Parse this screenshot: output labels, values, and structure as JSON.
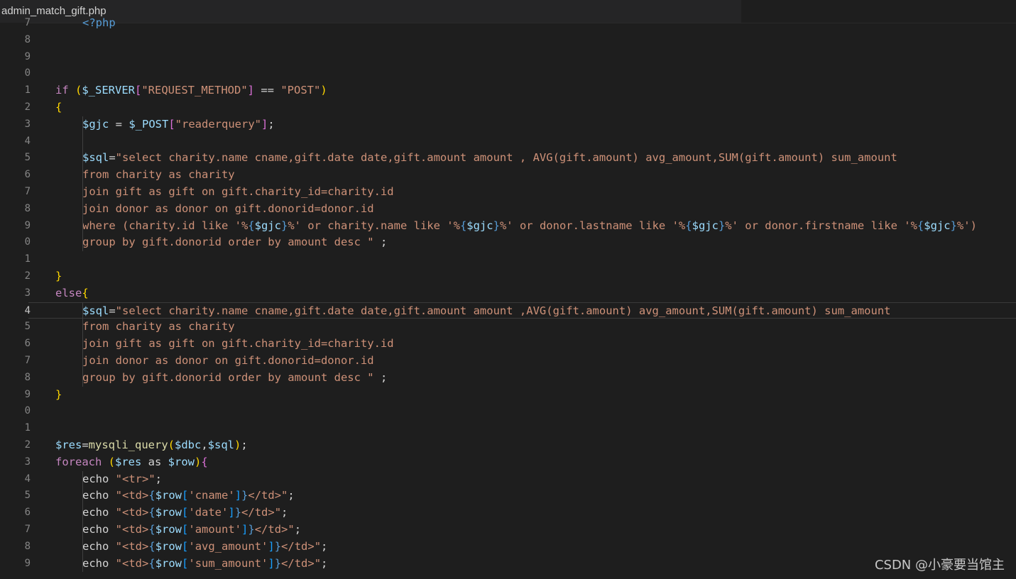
{
  "tab": {
    "filename": "admin_match_gift.php"
  },
  "watermark": "CSDN @小豪要当馆主",
  "colors": {
    "background": "#1e1e1e",
    "keyword": "#569cd6",
    "variable": "#9cdcfe",
    "string": "#ce9178",
    "function": "#dcdcaa",
    "brace": "#ffd700",
    "paren": "#da70d6",
    "bracket": "#179fff"
  },
  "current_line_number": "4",
  "lines": [
    {
      "num": "7",
      "indent": 1,
      "tokens": [
        [
          "t-kw",
          "<?php"
        ]
      ]
    },
    {
      "num": "8",
      "indent": 0,
      "tokens": []
    },
    {
      "num": "9",
      "indent": 0,
      "tokens": []
    },
    {
      "num": "0",
      "indent": 0,
      "tokens": []
    },
    {
      "num": "1",
      "indent": 0,
      "tokens": [
        [
          "t-ctrl",
          "if "
        ],
        [
          "t-brace",
          "("
        ],
        [
          "t-var",
          "$_SERVER"
        ],
        [
          "t-paren",
          "["
        ],
        [
          "t-str",
          "\"REQUEST_METHOD\""
        ],
        [
          "t-paren",
          "]"
        ],
        [
          "t-plain",
          " == "
        ],
        [
          "t-str",
          "\"POST\""
        ],
        [
          "t-brace",
          ")"
        ]
      ]
    },
    {
      "num": "2",
      "indent": 0,
      "tokens": [
        [
          "t-brace",
          "{"
        ]
      ]
    },
    {
      "num": "3",
      "indent": 1,
      "tokens": [
        [
          "t-var",
          "$gjc"
        ],
        [
          "t-plain",
          " = "
        ],
        [
          "t-var",
          "$_POST"
        ],
        [
          "t-paren",
          "["
        ],
        [
          "t-str",
          "\"readerquery\""
        ],
        [
          "t-paren",
          "]"
        ],
        [
          "t-plain",
          ";"
        ]
      ]
    },
    {
      "num": "4",
      "indent": 0,
      "tokens": []
    },
    {
      "num": "5",
      "indent": 1,
      "tokens": [
        [
          "t-var",
          "$sql"
        ],
        [
          "t-plain",
          "="
        ],
        [
          "t-str",
          "\"select charity.name cname,gift.date date,gift.amount amount , AVG(gift.amount) avg_amount,SUM(gift.amount) sum_amount"
        ]
      ]
    },
    {
      "num": "6",
      "indent": 1,
      "tokens": [
        [
          "t-str",
          "from charity as charity"
        ]
      ]
    },
    {
      "num": "7",
      "indent": 1,
      "tokens": [
        [
          "t-str",
          "join gift as gift on gift.charity_id=charity.id"
        ]
      ]
    },
    {
      "num": "8",
      "indent": 1,
      "tokens": [
        [
          "t-str",
          "join donor as donor on gift.donorid=donor.id"
        ]
      ]
    },
    {
      "num": "9",
      "indent": 1,
      "tokens": [
        [
          "t-str",
          "where (charity.id like '%"
        ],
        [
          "t-kw",
          "{"
        ],
        [
          "t-var",
          "$gjc"
        ],
        [
          "t-kw",
          "}"
        ],
        [
          "t-str",
          "%' or charity.name like '%"
        ],
        [
          "t-kw",
          "{"
        ],
        [
          "t-var",
          "$gjc"
        ],
        [
          "t-kw",
          "}"
        ],
        [
          "t-str",
          "%' or donor.lastname like '%"
        ],
        [
          "t-kw",
          "{"
        ],
        [
          "t-var",
          "$gjc"
        ],
        [
          "t-kw",
          "}"
        ],
        [
          "t-str",
          "%' or donor.firstname like '%"
        ],
        [
          "t-kw",
          "{"
        ],
        [
          "t-var",
          "$gjc"
        ],
        [
          "t-kw",
          "}"
        ],
        [
          "t-str",
          "%')"
        ]
      ]
    },
    {
      "num": "0",
      "indent": 1,
      "tokens": [
        [
          "t-str",
          "group by gift.donorid order by amount desc \""
        ],
        [
          "t-plain",
          " ;"
        ]
      ]
    },
    {
      "num": "1",
      "indent": 0,
      "tokens": []
    },
    {
      "num": "2",
      "indent": 0,
      "tokens": [
        [
          "t-brace",
          "}"
        ]
      ]
    },
    {
      "num": "3",
      "indent": 0,
      "tokens": [
        [
          "t-ctrl",
          "else"
        ],
        [
          "t-brace",
          "{"
        ]
      ]
    },
    {
      "num": "4",
      "indent": 1,
      "current": true,
      "tokens": [
        [
          "t-var",
          "$sql"
        ],
        [
          "t-plain",
          "="
        ],
        [
          "t-str",
          "\"select charity.name cname,gift.date date,gift.amount amount ,AVG(gift.amount) avg_amount,SUM(gift.amount) sum_amount"
        ]
      ]
    },
    {
      "num": "5",
      "indent": 1,
      "tokens": [
        [
          "t-str",
          "from charity as charity"
        ]
      ]
    },
    {
      "num": "6",
      "indent": 1,
      "tokens": [
        [
          "t-str",
          "join gift as gift on gift.charity_id=charity.id"
        ]
      ]
    },
    {
      "num": "7",
      "indent": 1,
      "tokens": [
        [
          "t-str",
          "join donor as donor on gift.donorid=donor.id"
        ]
      ]
    },
    {
      "num": "8",
      "indent": 1,
      "tokens": [
        [
          "t-str",
          "group by gift.donorid order by amount desc \""
        ],
        [
          "t-plain",
          " ;"
        ]
      ]
    },
    {
      "num": "9",
      "indent": 0,
      "tokens": [
        [
          "t-brace",
          "}"
        ]
      ]
    },
    {
      "num": "0",
      "indent": 0,
      "tokens": []
    },
    {
      "num": "1",
      "indent": 0,
      "tokens": []
    },
    {
      "num": "2",
      "indent": 0,
      "tokens": [
        [
          "t-var",
          "$res"
        ],
        [
          "t-plain",
          "="
        ],
        [
          "t-fn",
          "mysqli_query"
        ],
        [
          "t-brace",
          "("
        ],
        [
          "t-var",
          "$dbc"
        ],
        [
          "t-plain",
          ","
        ],
        [
          "t-var",
          "$sql"
        ],
        [
          "t-brace",
          ")"
        ],
        [
          "t-plain",
          ";"
        ]
      ]
    },
    {
      "num": "3",
      "indent": 0,
      "tokens": [
        [
          "t-ctrl",
          "foreach "
        ],
        [
          "t-brace",
          "("
        ],
        [
          "t-var",
          "$res"
        ],
        [
          "t-plain",
          " as "
        ],
        [
          "t-var",
          "$row"
        ],
        [
          "t-brace",
          ")"
        ],
        [
          "t-paren",
          "{"
        ]
      ]
    },
    {
      "num": "4",
      "indent": 1,
      "tokens": [
        [
          "t-plain",
          "echo "
        ],
        [
          "t-str",
          "\"<tr>\""
        ],
        [
          "t-plain",
          ";"
        ]
      ]
    },
    {
      "num": "5",
      "indent": 1,
      "tokens": [
        [
          "t-plain",
          "echo "
        ],
        [
          "t-str",
          "\"<td>"
        ],
        [
          "t-kw",
          "{"
        ],
        [
          "t-var",
          "$row"
        ],
        [
          "t-brack",
          "["
        ],
        [
          "t-str",
          "'cname'"
        ],
        [
          "t-brack",
          "]"
        ],
        [
          "t-kw",
          "}"
        ],
        [
          "t-str",
          "</td>\""
        ],
        [
          "t-plain",
          ";"
        ]
      ]
    },
    {
      "num": "6",
      "indent": 1,
      "tokens": [
        [
          "t-plain",
          "echo "
        ],
        [
          "t-str",
          "\"<td>"
        ],
        [
          "t-kw",
          "{"
        ],
        [
          "t-var",
          "$row"
        ],
        [
          "t-brack",
          "["
        ],
        [
          "t-str",
          "'date'"
        ],
        [
          "t-brack",
          "]"
        ],
        [
          "t-kw",
          "}"
        ],
        [
          "t-str",
          "</td>\""
        ],
        [
          "t-plain",
          ";"
        ]
      ]
    },
    {
      "num": "7",
      "indent": 1,
      "tokens": [
        [
          "t-plain",
          "echo "
        ],
        [
          "t-str",
          "\"<td>"
        ],
        [
          "t-kw",
          "{"
        ],
        [
          "t-var",
          "$row"
        ],
        [
          "t-brack",
          "["
        ],
        [
          "t-str",
          "'amount'"
        ],
        [
          "t-brack",
          "]"
        ],
        [
          "t-kw",
          "}"
        ],
        [
          "t-str",
          "</td>\""
        ],
        [
          "t-plain",
          ";"
        ]
      ]
    },
    {
      "num": "8",
      "indent": 1,
      "tokens": [
        [
          "t-plain",
          "echo "
        ],
        [
          "t-str",
          "\"<td>"
        ],
        [
          "t-kw",
          "{"
        ],
        [
          "t-var",
          "$row"
        ],
        [
          "t-brack",
          "["
        ],
        [
          "t-str",
          "'avg_amount'"
        ],
        [
          "t-brack",
          "]"
        ],
        [
          "t-kw",
          "}"
        ],
        [
          "t-str",
          "</td>\""
        ],
        [
          "t-plain",
          ";"
        ]
      ]
    },
    {
      "num": "9",
      "indent": 1,
      "tokens": [
        [
          "t-plain",
          "echo "
        ],
        [
          "t-str",
          "\"<td>"
        ],
        [
          "t-kw",
          "{"
        ],
        [
          "t-var",
          "$row"
        ],
        [
          "t-brack",
          "["
        ],
        [
          "t-str",
          "'sum_amount'"
        ],
        [
          "t-brack",
          "]"
        ],
        [
          "t-kw",
          "}"
        ],
        [
          "t-str",
          "</td>\""
        ],
        [
          "t-plain",
          ";"
        ]
      ]
    }
  ]
}
